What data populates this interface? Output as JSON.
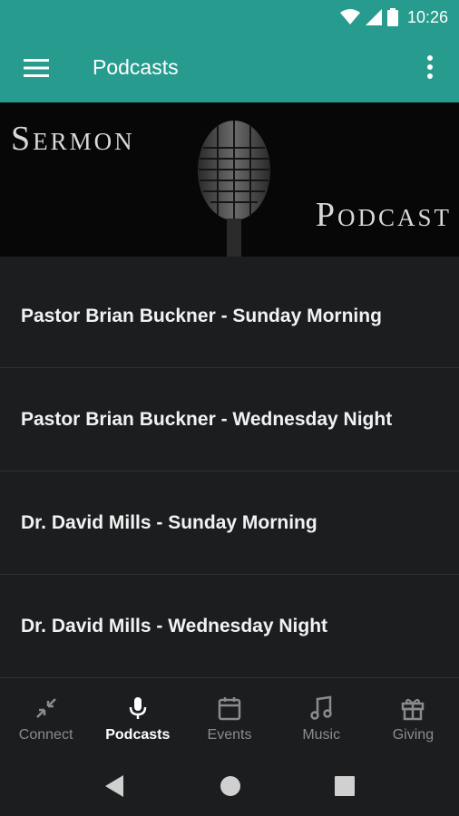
{
  "status": {
    "time": "10:26"
  },
  "appbar": {
    "title": "Podcasts"
  },
  "banner": {
    "line1": "Sermon",
    "line2": "Podcast"
  },
  "podcasts": [
    {
      "label": "Pastor Brian Buckner - Sunday Morning"
    },
    {
      "label": "Pastor Brian Buckner - Wednesday Night"
    },
    {
      "label": "Dr. David Mills - Sunday Morning"
    },
    {
      "label": "Dr. David Mills - Wednesday Night"
    }
  ],
  "nav": [
    {
      "label": "Connect",
      "icon": "compress-arrows-icon"
    },
    {
      "label": "Podcasts",
      "icon": "microphone-icon",
      "active": true
    },
    {
      "label": "Events",
      "icon": "calendar-icon"
    },
    {
      "label": "Music",
      "icon": "music-note-icon"
    },
    {
      "label": "Giving",
      "icon": "gift-icon"
    }
  ],
  "colors": {
    "accent": "#279b8e",
    "background": "#1c1d1f",
    "active": "#ffffff",
    "inactive": "#8a8b8d"
  }
}
